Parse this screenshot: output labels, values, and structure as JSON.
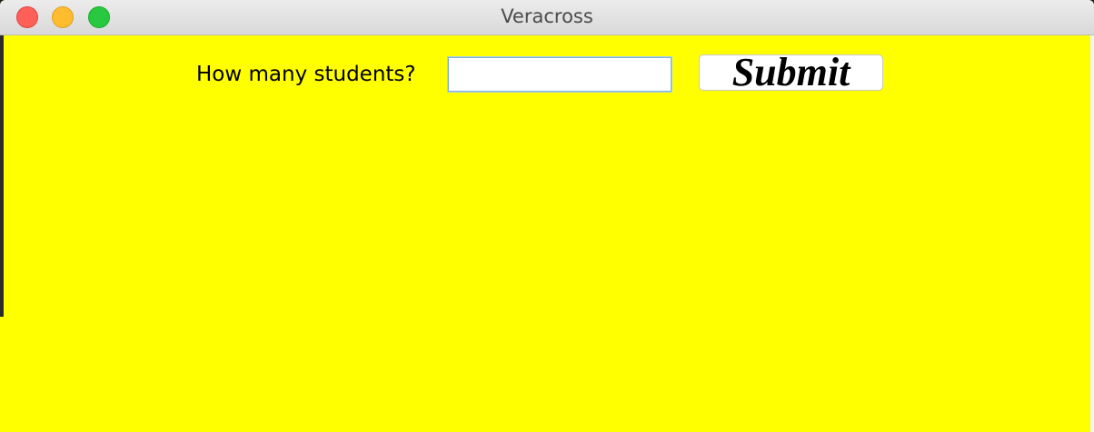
{
  "window": {
    "title": "Veracross"
  },
  "form": {
    "prompt_label": "How many students?",
    "students_input_value": "",
    "submit_label": "Submit"
  },
  "colors": {
    "background": "#ffff00",
    "titlebar": "#e3e3e3"
  }
}
